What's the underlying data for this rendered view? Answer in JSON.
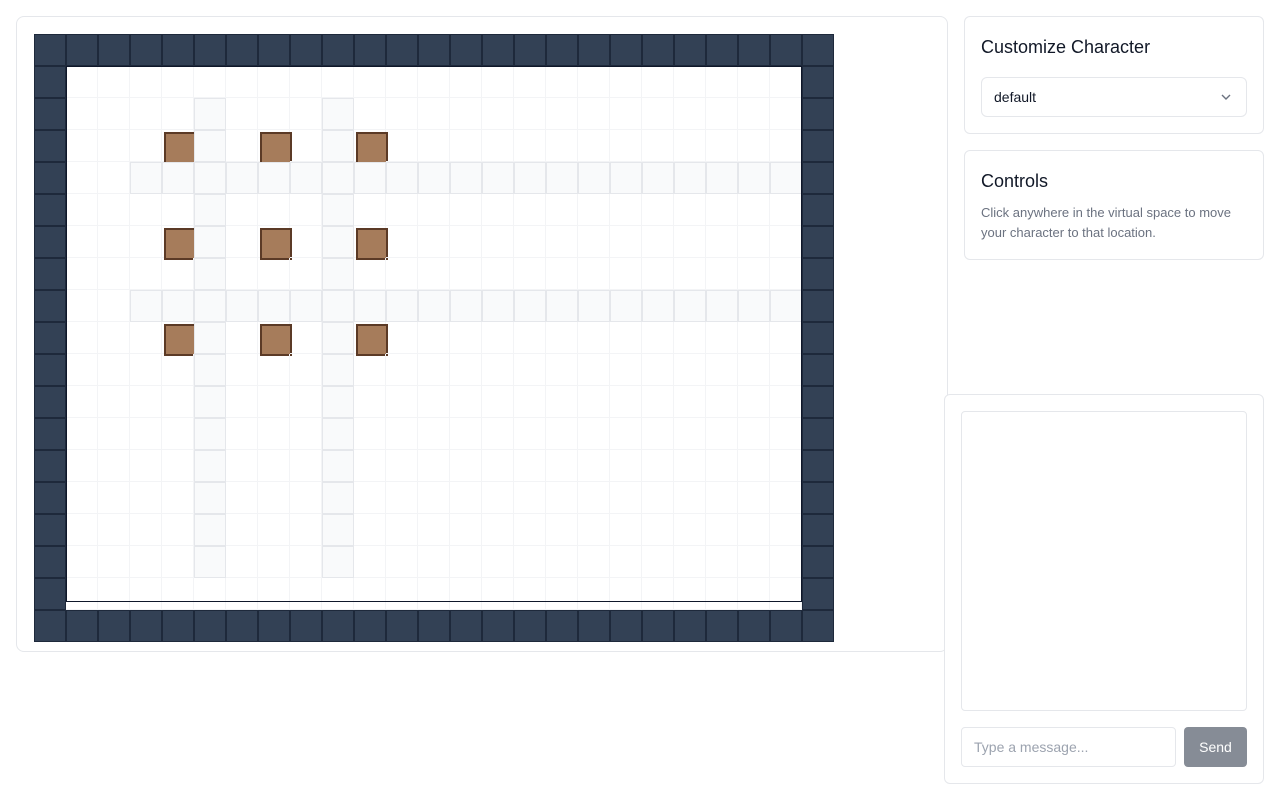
{
  "customize": {
    "title": "Customize Character",
    "selected_option": "default"
  },
  "controls": {
    "title": "Controls",
    "description": "Click anywhere in the virtual space to move your character to that location."
  },
  "chat": {
    "input_placeholder": "Type a message...",
    "input_value": "",
    "send_label": "Send"
  },
  "colors": {
    "wall": "#334155",
    "path": "#f9fafb",
    "desk": "#a67c5b",
    "send_button": "#868c96"
  },
  "map": {
    "rows": [
      "WWWWWWWWWWWWWWWWWWWWWWWWW",
      "W.......................W",
      "W....P...P..............W",
      "W...DP.D.PD.............W",
      "W..PPPPPPPPPPPPPPPPPPPPPW",
      "W....P...P..............W",
      "W...DP.D.PD.............W",
      "W....P...P..............W",
      "W..PPPPPPPPPPPPPPPPPPPPPW",
      "W...DP.D.PD.............W",
      "W....P...P..............W",
      "W....P...P..............W",
      "W....P...P..............W",
      "W....P...P..............W",
      "W....P...P..............W",
      "W....P...P..............W",
      "W....P...P..............W",
      "W.......................W",
      "WWWWWWWWWWWWWWWWWWWWWWWWW"
    ]
  }
}
